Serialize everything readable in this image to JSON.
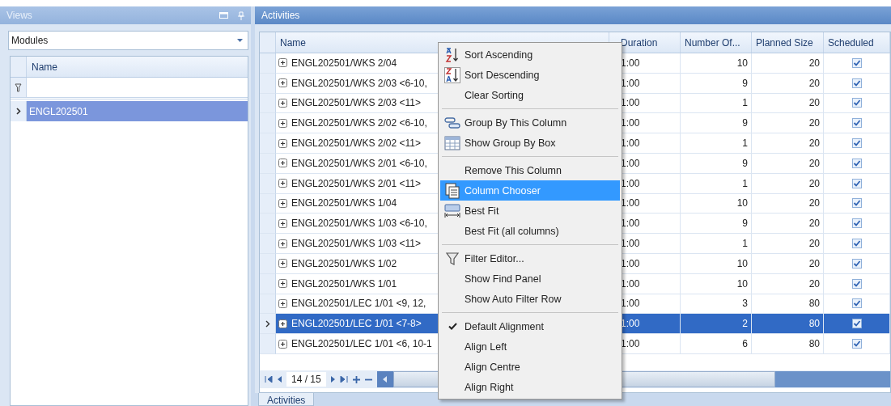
{
  "views_panel": {
    "title": "Views",
    "combo": {
      "value": "Modules"
    },
    "grid": {
      "column": "Name",
      "rows": [
        {
          "name": "ENGL202501",
          "selected": true
        }
      ]
    }
  },
  "activities_panel": {
    "title": "Activities",
    "columns": [
      "Name",
      "Duration",
      "Number Of...",
      "Planned Size",
      "Scheduled"
    ],
    "rows": [
      {
        "name": "ENGL202501/WKS 2/04",
        "duration": "1:00",
        "number": "10",
        "planned": "20",
        "scheduled": true,
        "selected": false
      },
      {
        "name": "ENGL202501/WKS 2/03 <6-10,",
        "duration": "1:00",
        "number": "9",
        "planned": "20",
        "scheduled": true,
        "selected": false
      },
      {
        "name": "ENGL202501/WKS 2/03 <11>",
        "duration": "1:00",
        "number": "1",
        "planned": "20",
        "scheduled": true,
        "selected": false
      },
      {
        "name": "ENGL202501/WKS 2/02 <6-10,",
        "duration": "1:00",
        "number": "9",
        "planned": "20",
        "scheduled": true,
        "selected": false
      },
      {
        "name": "ENGL202501/WKS 2/02 <11>",
        "duration": "1:00",
        "number": "1",
        "planned": "20",
        "scheduled": true,
        "selected": false
      },
      {
        "name": "ENGL202501/WKS 2/01 <6-10,",
        "duration": "1:00",
        "number": "9",
        "planned": "20",
        "scheduled": true,
        "selected": false
      },
      {
        "name": "ENGL202501/WKS 2/01 <11>",
        "duration": "1:00",
        "number": "1",
        "planned": "20",
        "scheduled": true,
        "selected": false
      },
      {
        "name": "ENGL202501/WKS 1/04",
        "duration": "1:00",
        "number": "10",
        "planned": "20",
        "scheduled": true,
        "selected": false
      },
      {
        "name": "ENGL202501/WKS 1/03 <6-10,",
        "duration": "1:00",
        "number": "9",
        "planned": "20",
        "scheduled": true,
        "selected": false
      },
      {
        "name": "ENGL202501/WKS 1/03 <11>",
        "duration": "1:00",
        "number": "1",
        "planned": "20",
        "scheduled": true,
        "selected": false
      },
      {
        "name": "ENGL202501/WKS 1/02",
        "duration": "1:00",
        "number": "10",
        "planned": "20",
        "scheduled": true,
        "selected": false
      },
      {
        "name": "ENGL202501/WKS 1/01",
        "duration": "1:00",
        "number": "10",
        "planned": "20",
        "scheduled": true,
        "selected": false
      },
      {
        "name": "ENGL202501/LEC 1/01 <9, 12,",
        "duration": "1:00",
        "number": "3",
        "planned": "80",
        "scheduled": true,
        "selected": false
      },
      {
        "name": "ENGL202501/LEC 1/01 <7-8>",
        "duration": "1:00",
        "number": "2",
        "planned": "80",
        "scheduled": true,
        "selected": true
      },
      {
        "name": "ENGL202501/LEC 1/01 <6, 10-1",
        "duration": "1:00",
        "number": "6",
        "planned": "80",
        "scheduled": true,
        "selected": false
      }
    ],
    "pager": "14 / 15",
    "bottom_tab": "Activities"
  },
  "context_menu": {
    "groups": [
      [
        {
          "label": "Sort Ascending",
          "selected": false,
          "checked": false
        },
        {
          "label": "Sort Descending",
          "selected": false,
          "checked": false
        },
        {
          "label": "Clear Sorting",
          "selected": false,
          "checked": false
        }
      ],
      [
        {
          "label": "Group By This Column",
          "selected": false,
          "checked": false
        },
        {
          "label": "Show Group By Box",
          "selected": false,
          "checked": false
        }
      ],
      [
        {
          "label": "Remove This Column",
          "selected": false,
          "checked": false
        },
        {
          "label": "Column Chooser",
          "selected": true,
          "checked": false
        },
        {
          "label": "Best Fit",
          "selected": false,
          "checked": false
        },
        {
          "label": "Best Fit (all columns)",
          "selected": false,
          "checked": false
        }
      ],
      [
        {
          "label": "Filter Editor...",
          "selected": false,
          "checked": false
        },
        {
          "label": "Show Find Panel",
          "selected": false,
          "checked": false
        },
        {
          "label": "Show Auto Filter Row",
          "selected": false,
          "checked": false
        }
      ],
      [
        {
          "label": "Default Alignment",
          "selected": false,
          "checked": true
        },
        {
          "label": "Align Left",
          "selected": false,
          "checked": false
        },
        {
          "label": "Align Centre",
          "selected": false,
          "checked": false
        },
        {
          "label": "Align Right",
          "selected": false,
          "checked": false
        }
      ]
    ]
  }
}
